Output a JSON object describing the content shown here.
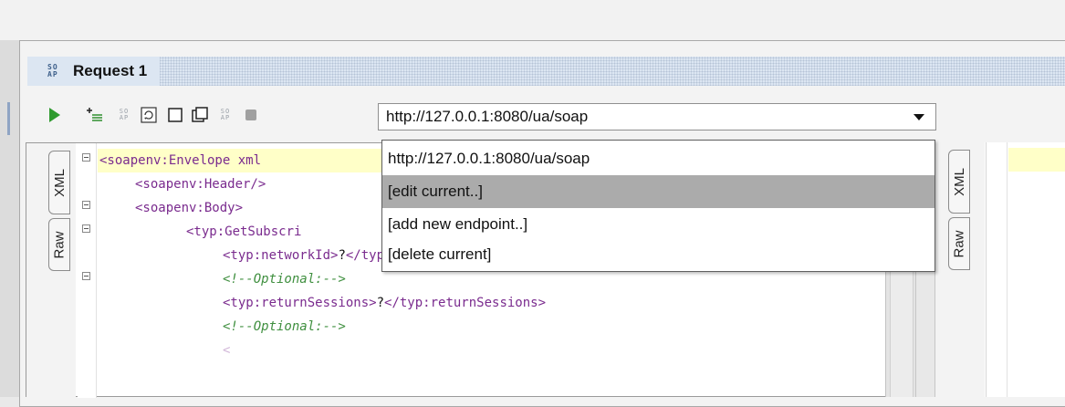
{
  "request": {
    "title": "Request 1",
    "soap_icon_top": "SO",
    "soap_icon_bottom": "AP"
  },
  "toolbar": {
    "run": "play-icon",
    "add": "add-header-icon",
    "soap_top": "SO",
    "soap_bottom": "AP",
    "endpoint": "http://127.0.0.1:8080/ua/soap"
  },
  "dropdown": {
    "options": [
      "http://127.0.0.1:8080/ua/soap",
      "[edit current..]",
      "[add new endpoint..]",
      "[delete current]"
    ],
    "selected_index": 1
  },
  "tabs": {
    "xml": "XML",
    "raw": "Raw"
  },
  "code": {
    "line1_tag": "<soapenv:Envelope",
    "line1_attr": " xml",
    "line2": "<soapenv:Header/>",
    "line3": "<soapenv:Body>",
    "line4": "<typ:GetSubscri",
    "line5_open": "<typ:networkId>",
    "line5_val": "?",
    "line5_close": "</typ:networkId>",
    "line6": "<!--Optional:-->",
    "line7_open": "<typ:returnSessions>",
    "line7_val": "?",
    "line7_close": "</typ:returnSessions>",
    "line8": "<!--Optional:-->"
  },
  "colors": {
    "tag": "#7a2b8e",
    "comment": "#3f8f3f",
    "highlight": "#ffffc8",
    "selected": "#ababab"
  }
}
